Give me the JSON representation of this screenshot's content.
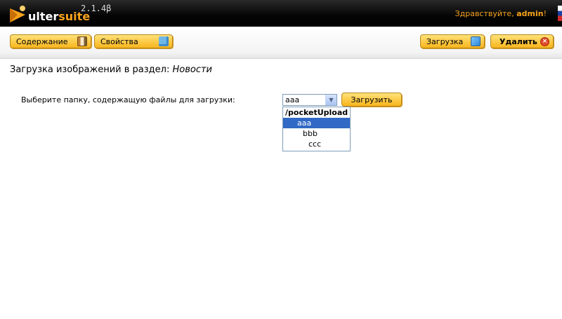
{
  "header": {
    "logo_part1": "ulter",
    "logo_part2": "suite",
    "version": "2.1.4β",
    "greeting_prefix": "Здравствуйте, ",
    "username": "admin",
    "greeting_suffix": "!",
    "accent_color": "#f7a21c"
  },
  "toolbar": {
    "content_label": "Содержание",
    "content_icon": "book-icon",
    "properties_label": "Свойства",
    "properties_icon": "puzzle-icon",
    "upload_label": "Загрузка",
    "upload_icon": "image-upload-icon",
    "delete_label": "Удалить",
    "delete_icon": "close-circle-icon"
  },
  "page": {
    "title_prefix": "Загрузка изображений в раздел: ",
    "section_name": "Новости"
  },
  "form": {
    "folder_label": "Выберите папку, содержащую файлы для загрузки:",
    "selected_folder": "aaa",
    "submit_label": "Загрузить",
    "options": [
      {
        "label": "/pocketUpload",
        "type": "group"
      },
      {
        "label": "aaa",
        "type": "l1",
        "selected": true
      },
      {
        "label": "bbb",
        "type": "l2"
      },
      {
        "label": "ccc",
        "type": "l3"
      }
    ]
  }
}
